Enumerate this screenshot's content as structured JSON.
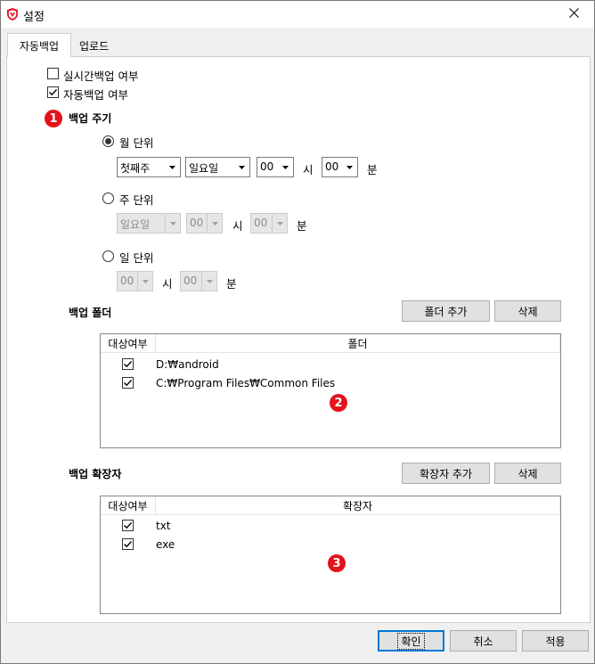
{
  "window": {
    "title": "설정"
  },
  "tabs": [
    {
      "label": "자동백업",
      "active": true
    },
    {
      "label": "업로드",
      "active": false
    }
  ],
  "options": {
    "realtime_backup": {
      "label": "실시간백업 여부",
      "checked": false
    },
    "auto_backup": {
      "label": "자동백업 여부",
      "checked": true
    }
  },
  "badges": {
    "one": "1",
    "two": "2",
    "three": "3",
    "color": "#e3131c"
  },
  "schedule": {
    "title": "백업 주기",
    "monthly": {
      "label": "월 단위",
      "selected": true,
      "week": "첫째주",
      "day": "일요일",
      "hour": "00",
      "hour_unit": "시",
      "minute": "00",
      "minute_unit": "분"
    },
    "weekly": {
      "label": "주 단위",
      "selected": false,
      "day": "일요일",
      "hour": "00",
      "hour_unit": "시",
      "minute": "00",
      "minute_unit": "분"
    },
    "daily": {
      "label": "일 단위",
      "selected": false,
      "hour": "00",
      "hour_unit": "시",
      "minute": "00",
      "minute_unit": "분"
    }
  },
  "folders": {
    "title": "백업 폴더",
    "add_label": "폴더 추가",
    "delete_label": "삭제",
    "columns": [
      "대상여부",
      "폴더"
    ],
    "rows": [
      {
        "checked": true,
        "path": "D:₩android"
      },
      {
        "checked": true,
        "path": "C:₩Program Files₩Common Files"
      }
    ]
  },
  "extensions": {
    "title": "백업 확장자",
    "add_label": "확장자 추가",
    "delete_label": "삭제",
    "columns": [
      "대상여부",
      "확장자"
    ],
    "rows": [
      {
        "checked": true,
        "ext": "txt"
      },
      {
        "checked": true,
        "ext": "exe"
      }
    ]
  },
  "footer": {
    "ok_label": "확인",
    "cancel_label": "취소",
    "apply_label": "적용"
  }
}
